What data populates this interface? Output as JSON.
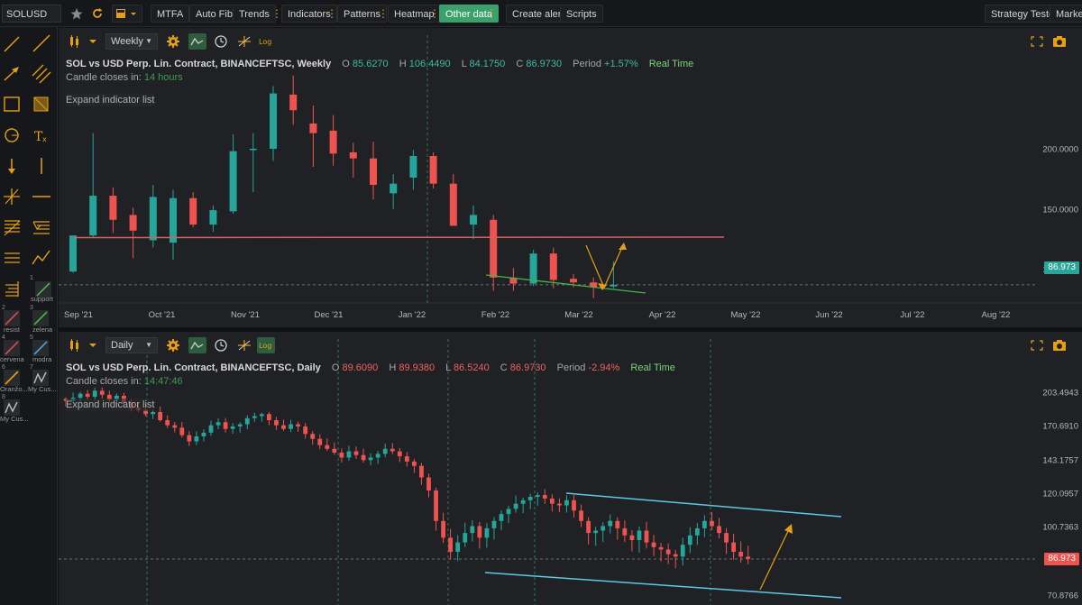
{
  "toolbar": {
    "symbol": "SOLUSD",
    "star_icon": "star-icon",
    "reload_icon": "reload-icon",
    "layout_icon": "chart-layout-icon",
    "buttons": [
      "MTFA",
      "Auto Fib",
      "Trends",
      "Indicators",
      "Patterns",
      "Heatmap",
      "Other data",
      "Create alert",
      "Scripts"
    ],
    "active_button": "Other data",
    "strategy_tester": "Strategy Tester",
    "market": "Market",
    "accent_color": "#e4a010",
    "active_color": "#3aa16a"
  },
  "sidebar": {
    "tools": [
      "trend-line-icon",
      "ray-line-icon",
      "arrow-line-icon",
      "parallel-channel-icon",
      "rectangle-icon",
      "shaded-box-icon",
      "circle-icon",
      "text-tool-icon",
      "down-arrow-icon",
      "vertical-line-icon",
      "cross-line-icon",
      "horizontal-line-icon",
      "fib-retracement-icon",
      "fib-extension-icon",
      "fib-channel-icon",
      "polyline-icon",
      "pitchfork-icon"
    ],
    "saved_templates": [
      {
        "num": "1",
        "label": "support",
        "color": "#45b44a"
      },
      {
        "num": "2",
        "label": "resist",
        "color": "#d94b4b"
      },
      {
        "num": "3",
        "label": "zelena",
        "color": "#45b44a"
      },
      {
        "num": "4",
        "label": "cervena",
        "color": "#d94b4b"
      },
      {
        "num": "5",
        "label": "modra",
        "color": "#4aa3e0"
      },
      {
        "num": "6",
        "label": "Oranžo...",
        "color": "#e4a010"
      },
      {
        "num": "7",
        "label": "My Cus...",
        "color": "#bdbdbd"
      },
      {
        "num": "8",
        "label": "My Cus...",
        "color": "#bdbdbd"
      }
    ]
  },
  "weekly": {
    "timeframe": "Weekly",
    "title": "SOL vs USD Perp. Lin. Contract, BINANCEFTSC, Weekly",
    "o_label": "O",
    "o": "85.6270",
    "h_label": "H",
    "h": "106.4490",
    "l_label": "L",
    "l": "84.1750",
    "c_label": "C",
    "c": "86.9730",
    "period_label": "Period",
    "period": "+1.57%",
    "realtime": "Real Time",
    "candle_closes_label": "Candle closes in:",
    "candle_closes": "14 hours",
    "expand": "Expand indicator list",
    "log_label": "Log",
    "price_tag": "86.973"
  },
  "daily": {
    "timeframe": "Daily",
    "title": "SOL vs USD Perp. Lin. Contract, BINANCEFTSC, Daily",
    "o_label": "O",
    "o": "89.6090",
    "h_label": "H",
    "h": "89.9380",
    "l_label": "L",
    "l": "86.5240",
    "c_label": "C",
    "c": "86.9730",
    "period_label": "Period",
    "period": "-2.94%",
    "realtime": "Real Time",
    "candle_closes_label": "Candle closes in:",
    "candle_closes": "14:47:46",
    "expand": "Expand indicator list",
    "log_label": "Log",
    "price_tag": "86.973"
  },
  "chart_data": [
    {
      "type": "candlestick",
      "title": "SOL vs USD Perp. Lin. Contract, BINANCEFTSC, Weekly",
      "x_ticks": [
        "Sep '21",
        "Oct '21",
        "Nov '21",
        "Dec '21",
        "Jan '22",
        "Feb '22",
        "Mar '22",
        "Apr '22",
        "May '22",
        "Jun '22",
        "Jul '22",
        "Aug '22"
      ],
      "y_ticks": [
        "200.0000",
        "150.0000",
        "100.0000"
      ],
      "last_price": 86.973,
      "candles": [
        {
          "o": 98,
          "h": 112,
          "l": 97,
          "c": 128
        },
        {
          "o": 128,
          "h": 213,
          "l": 126,
          "c": 161
        },
        {
          "o": 161,
          "h": 168,
          "l": 130,
          "c": 141
        },
        {
          "o": 145,
          "h": 151,
          "l": 109,
          "c": 132
        },
        {
          "o": 124,
          "h": 170,
          "l": 118,
          "c": 160
        },
        {
          "o": 122,
          "h": 166,
          "l": 108,
          "c": 159
        },
        {
          "o": 159,
          "h": 164,
          "l": 135,
          "c": 137
        },
        {
          "o": 137,
          "h": 153,
          "l": 131,
          "c": 149
        },
        {
          "o": 148,
          "h": 212,
          "l": 146,
          "c": 198
        },
        {
          "o": 199,
          "h": 213,
          "l": 164,
          "c": 200
        },
        {
          "o": 200,
          "h": 252,
          "l": 190,
          "c": 246
        },
        {
          "o": 245,
          "h": 261,
          "l": 220,
          "c": 232
        },
        {
          "o": 221,
          "h": 236,
          "l": 185,
          "c": 213
        },
        {
          "o": 215,
          "h": 228,
          "l": 186,
          "c": 196
        },
        {
          "o": 197,
          "h": 205,
          "l": 176,
          "c": 192
        },
        {
          "o": 192,
          "h": 206,
          "l": 158,
          "c": 170
        },
        {
          "o": 163,
          "h": 179,
          "l": 150,
          "c": 171
        },
        {
          "o": 176,
          "h": 199,
          "l": 166,
          "c": 194
        },
        {
          "o": 194,
          "h": 197,
          "l": 167,
          "c": 171
        },
        {
          "o": 171,
          "h": 179,
          "l": 141,
          "c": 136
        },
        {
          "o": 137,
          "h": 153,
          "l": 125,
          "c": 145
        },
        {
          "o": 141,
          "h": 145,
          "l": 82,
          "c": 93
        },
        {
          "o": 93,
          "h": 101,
          "l": 82,
          "c": 88
        },
        {
          "o": 88,
          "h": 116,
          "l": 86,
          "c": 113
        },
        {
          "o": 113,
          "h": 118,
          "l": 84,
          "c": 91
        },
        {
          "o": 92,
          "h": 96,
          "l": 85,
          "c": 89
        },
        {
          "o": 89,
          "h": 93,
          "l": 76,
          "c": 85
        },
        {
          "o": 85.627,
          "h": 106.449,
          "l": 84.175,
          "c": 86.973
        }
      ],
      "annotations": [
        "horizontal support line ~98",
        "descending green trend line",
        "orange arrow up"
      ]
    },
    {
      "type": "candlestick",
      "title": "SOL vs USD Perp. Lin. Contract, BINANCEFTSC, Daily",
      "y_ticks": [
        "203.4943",
        "170.6910",
        "143.1757",
        "120.0957",
        "100.7363",
        "86.973",
        "70.8766"
      ],
      "last_price": 86.973,
      "price_path": [
        195,
        198,
        202,
        199,
        205,
        201,
        196,
        200,
        193,
        188,
        186,
        182,
        184,
        176,
        171,
        169,
        163,
        158,
        162,
        165,
        171,
        174,
        168,
        170,
        172,
        178,
        180,
        182,
        176,
        171,
        168,
        172,
        170,
        164,
        160,
        155,
        152,
        149,
        145,
        150,
        147,
        143,
        145,
        148,
        152,
        150,
        146,
        142,
        139,
        131,
        122,
        104,
        96,
        90,
        94,
        98,
        101,
        96,
        100,
        104,
        108,
        111,
        114,
        116,
        118,
        119,
        117,
        114,
        113,
        116,
        110,
        104,
        98,
        99,
        101,
        104,
        100,
        97,
        95,
        99,
        94,
        92,
        91,
        89,
        88,
        93,
        97,
        100,
        104,
        101,
        98,
        94,
        90,
        88,
        87
      ],
      "annotations": [
        "descending channel (cyan)",
        "orange arrow up"
      ]
    }
  ]
}
